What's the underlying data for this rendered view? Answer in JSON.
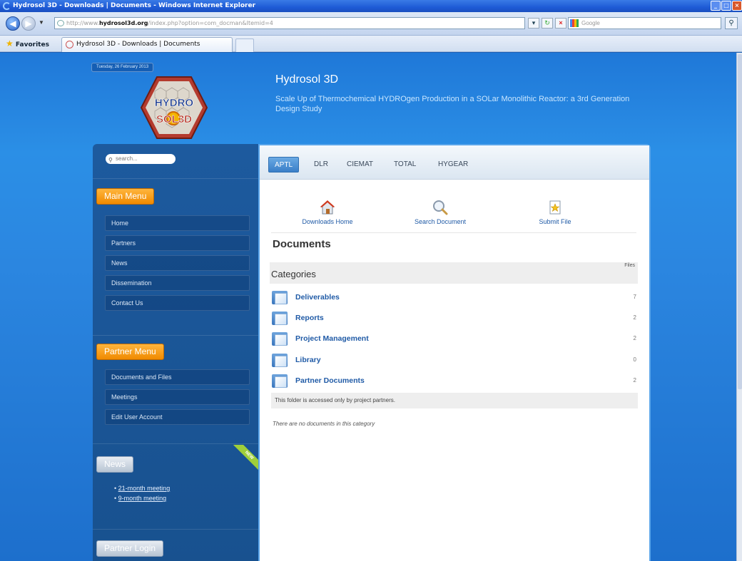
{
  "browser": {
    "window_title": "Hydrosol 3D - Downloads | Documents - Windows Internet Explorer",
    "address_prefix": "http://www.",
    "address_domain": "hydrosol3d.org",
    "address_rest": "/index.php?option=com_docman&Itemid=4",
    "search_placeholder": "Google",
    "favorites_label": "Favorites",
    "tab_title": "Hydrosol 3D - Downloads | Documents"
  },
  "header": {
    "date": "Tuesday, 26 February 2013",
    "logo_text_top": "HYDRO",
    "logo_text_bottom": "SOL3D",
    "site_title": "Hydrosol 3D",
    "site_subtitle": "Scale Up of Thermochemical HYDROgen Production in a SOLar Monolithic Reactor: a 3rd Generation Design Study"
  },
  "sidebar": {
    "search_placeholder": "search...",
    "main_menu_title": "Main Menu",
    "main_menu": [
      "Home",
      "Partners",
      "News",
      "Dissemination",
      "Contact Us"
    ],
    "partner_menu_title": "Partner Menu",
    "partner_menu": [
      "Documents and Files",
      "Meetings",
      "Edit User Account"
    ],
    "news_title": "News",
    "news_ribbon": "NEW",
    "news_items": [
      "21-month meeting",
      "9-month meeting"
    ],
    "login_title": "Partner Login"
  },
  "main": {
    "tabs": [
      "APTL",
      "DLR",
      "CIEMAT",
      "TOTAL",
      "HYGEAR"
    ],
    "active_tab": "APTL",
    "links": {
      "downloads_home": "Downloads Home",
      "search_document": "Search Document",
      "submit_file": "Submit File"
    },
    "documents_title": "Documents",
    "categories_title": "Categories",
    "files_header": "Files",
    "categories": [
      {
        "name": "Deliverables",
        "count": "7"
      },
      {
        "name": "Reports",
        "count": "2"
      },
      {
        "name": "Project Management",
        "count": "2"
      },
      {
        "name": "Library",
        "count": "0"
      },
      {
        "name": "Partner Documents",
        "count": "2"
      }
    ],
    "partner_note": "This folder is accessed only by project partners.",
    "empty_note": "There are no documents in this category"
  },
  "colors": {
    "accent_orange": "#f08a00",
    "link_blue": "#1f5aa6",
    "page_blue": "#2b8fe6"
  }
}
